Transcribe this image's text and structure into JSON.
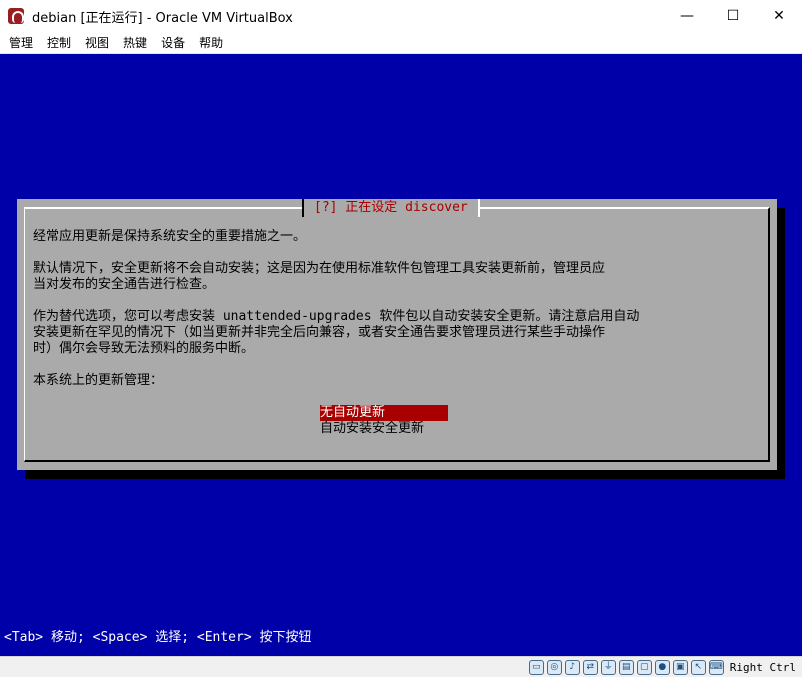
{
  "window": {
    "title": "debian [正在运行] - Oracle VM VirtualBox",
    "minimize_glyph": "—",
    "maximize_glyph": "☐",
    "close_glyph": "✕"
  },
  "menu": [
    "管理",
    "控制",
    "视图",
    "热键",
    "设备",
    "帮助"
  ],
  "dialog": {
    "title": "[?] 正在设定 discover",
    "para1": "经常应用更新是保持系统安全的重要措施之一。",
    "para2_line1": "默认情况下，安全更新将不会自动安装；这是因为在使用标准软件包管理工具安装更新前，管理员应",
    "para2_line2": "当对发布的安全通告进行检查。",
    "para3_line1": "作为替代选项，您可以考虑安装 unattended-upgrades 软件包以自动安装安全更新。请注意启用自动",
    "para3_line2": "安装更新在罕见的情况下（如当更新并非完全后向兼容，或者安全通告要求管理员进行某些手动操作",
    "para3_line3": "时）偶尔会导致无法预料的服务中断。",
    "prompt": "本系统上的更新管理：",
    "options": [
      "无自动更新",
      "自动安装安全更新"
    ],
    "selected_index": 0
  },
  "hint": "<Tab> 移动; <Space> 选择; <Enter> 按下按钮",
  "statusbar": {
    "icons": [
      "hdd-icon",
      "optical-icon",
      "audio-icon",
      "network-icon",
      "usb-icon",
      "shared-folder-icon",
      "display-icon",
      "recording-icon",
      "cpu-icon",
      "mouse-icon",
      "keyboard-icon"
    ],
    "host_key": "Right Ctrl"
  },
  "colors": {
    "screen_bg": "#0000a8",
    "dialog_bg": "#aaaaaa",
    "title_fg": "#a80000",
    "selected_bg": "#a80000"
  }
}
